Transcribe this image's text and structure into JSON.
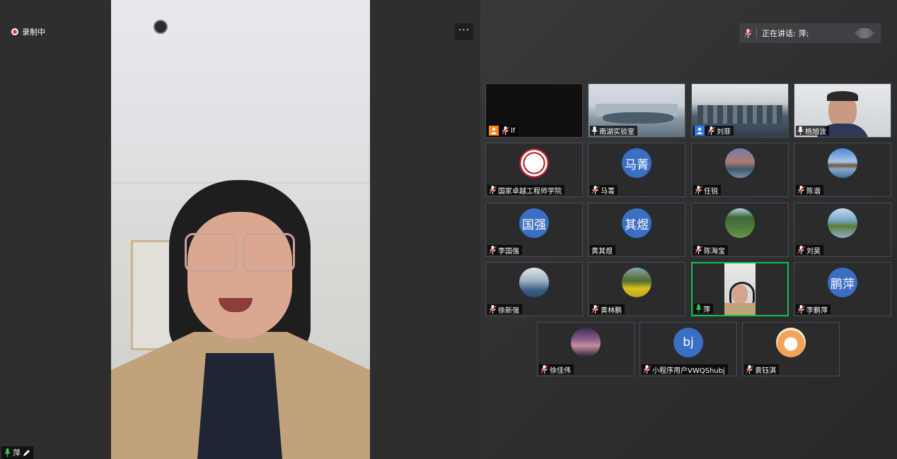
{
  "recording": {
    "label": "录制中"
  },
  "more_menu": {
    "glyph": "···"
  },
  "main_speaker": {
    "name": "萍",
    "mic": "mic-on-green"
  },
  "speaking_now": {
    "label": "正在讲话:",
    "name": "萍;"
  },
  "tiles": [
    {
      "name": "lf",
      "kind": "video-dark",
      "mic": "muted",
      "badge": "person-orange"
    },
    {
      "name": "南湖实验室",
      "kind": "video-room",
      "mic": "on"
    },
    {
      "name": "刘菲",
      "kind": "video-room-2",
      "mic": "muted",
      "badge": "person-blue"
    },
    {
      "name": "杨旭波",
      "kind": "video-man",
      "mic": "on"
    },
    {
      "name": "国家卓越工程师学院",
      "kind": "logo",
      "mic": "muted"
    },
    {
      "name": "马菁",
      "kind": "initials",
      "initials": "马菁",
      "mic": "muted"
    },
    {
      "name": "任锐",
      "kind": "photo-city",
      "mic": "muted"
    },
    {
      "name": "陈谐",
      "kind": "photo-lake",
      "mic": "muted"
    },
    {
      "name": "李国强",
      "kind": "initials",
      "initials": "国强",
      "mic": "muted"
    },
    {
      "name": "黄其煜",
      "kind": "initials",
      "initials": "其煜",
      "mic": "none"
    },
    {
      "name": "陈海宝",
      "kind": "photo-tree",
      "mic": "muted"
    },
    {
      "name": "刘昊",
      "kind": "photo-trees",
      "mic": "muted"
    },
    {
      "name": "徐新强",
      "kind": "photo-sea",
      "mic": "muted"
    },
    {
      "name": "黄林鹏",
      "kind": "photo-flowers",
      "mic": "muted"
    },
    {
      "name": "萍",
      "kind": "video-self",
      "mic": "on-green",
      "active": true
    },
    {
      "name": "李鹏萍",
      "kind": "initials",
      "initials": "鹏萍",
      "mic": "muted"
    },
    {
      "name": "徐佳伟",
      "kind": "photo-night",
      "mic": "muted"
    },
    {
      "name": "小程序用户VWQShubj",
      "kind": "initials",
      "initials": "bj",
      "mic": "muted"
    },
    {
      "name": "袁钰淇",
      "kind": "photo-dog",
      "mic": "muted"
    }
  ],
  "colors": {
    "avatar_blue": "#3a6fc4",
    "active_border": "#12c34b",
    "record_red": "#e53935",
    "mute_red": "#e53935"
  }
}
